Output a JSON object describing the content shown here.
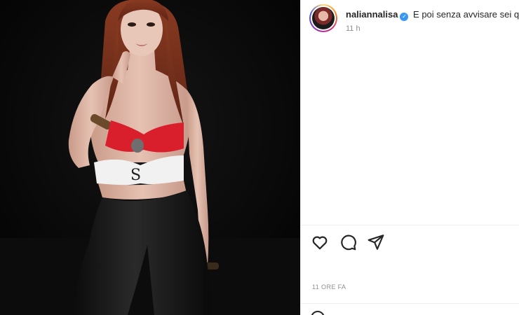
{
  "post": {
    "username": "naliannalisa",
    "verified_glyph": "✓",
    "caption": "E poi senza avvisare sei qu",
    "time_short": "11 h",
    "time_long": "11 ORE FA"
  },
  "icons": {
    "like": "heart-icon",
    "comment": "comment-icon",
    "share": "share-icon",
    "verified": "verified-badge-icon",
    "emoji": "emoji-icon"
  },
  "colors": {
    "background_photo": "#060606",
    "text_primary": "#262626",
    "text_secondary": "#8e8e8e",
    "verified_blue": "#3897f0",
    "separator": "#efefef"
  }
}
